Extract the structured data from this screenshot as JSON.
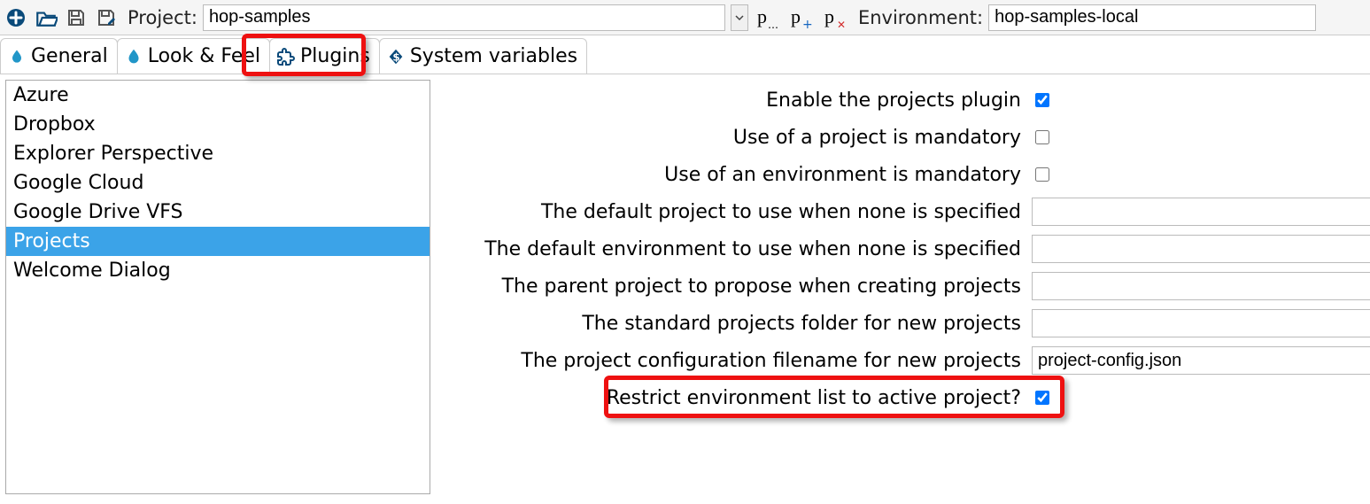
{
  "toolbar": {
    "project_label": "Project:",
    "project_value": "hop-samples",
    "environment_label": "Environment:",
    "environment_value": "hop-samples-local"
  },
  "tabs": [
    {
      "label": "General"
    },
    {
      "label": "Look & Feel"
    },
    {
      "label": "Plugins"
    },
    {
      "label": "System variables"
    }
  ],
  "sidebar": {
    "items": [
      "Azure",
      "Dropbox",
      "Explorer Perspective",
      "Google Cloud",
      "Google Drive VFS",
      "Projects",
      "Welcome Dialog"
    ],
    "selected_index": 5
  },
  "form": {
    "rows": [
      {
        "label": "Enable the projects plugin",
        "type": "check",
        "checked": true
      },
      {
        "label": "Use of a project is mandatory",
        "type": "check",
        "checked": false
      },
      {
        "label": "Use of an environment is mandatory",
        "type": "check",
        "checked": false
      },
      {
        "label": "The default project to use when none is specified",
        "type": "text",
        "value": ""
      },
      {
        "label": "The default environment to use when none is specified",
        "type": "text",
        "value": ""
      },
      {
        "label": "The parent project to propose when creating projects",
        "type": "text",
        "value": ""
      },
      {
        "label": "The standard projects folder for new projects",
        "type": "text",
        "value": ""
      },
      {
        "label": "The project configuration filename for new projects",
        "type": "text",
        "value": "project-config.json"
      },
      {
        "label": "Restrict environment list to active project?",
        "type": "check",
        "checked": true
      }
    ]
  }
}
